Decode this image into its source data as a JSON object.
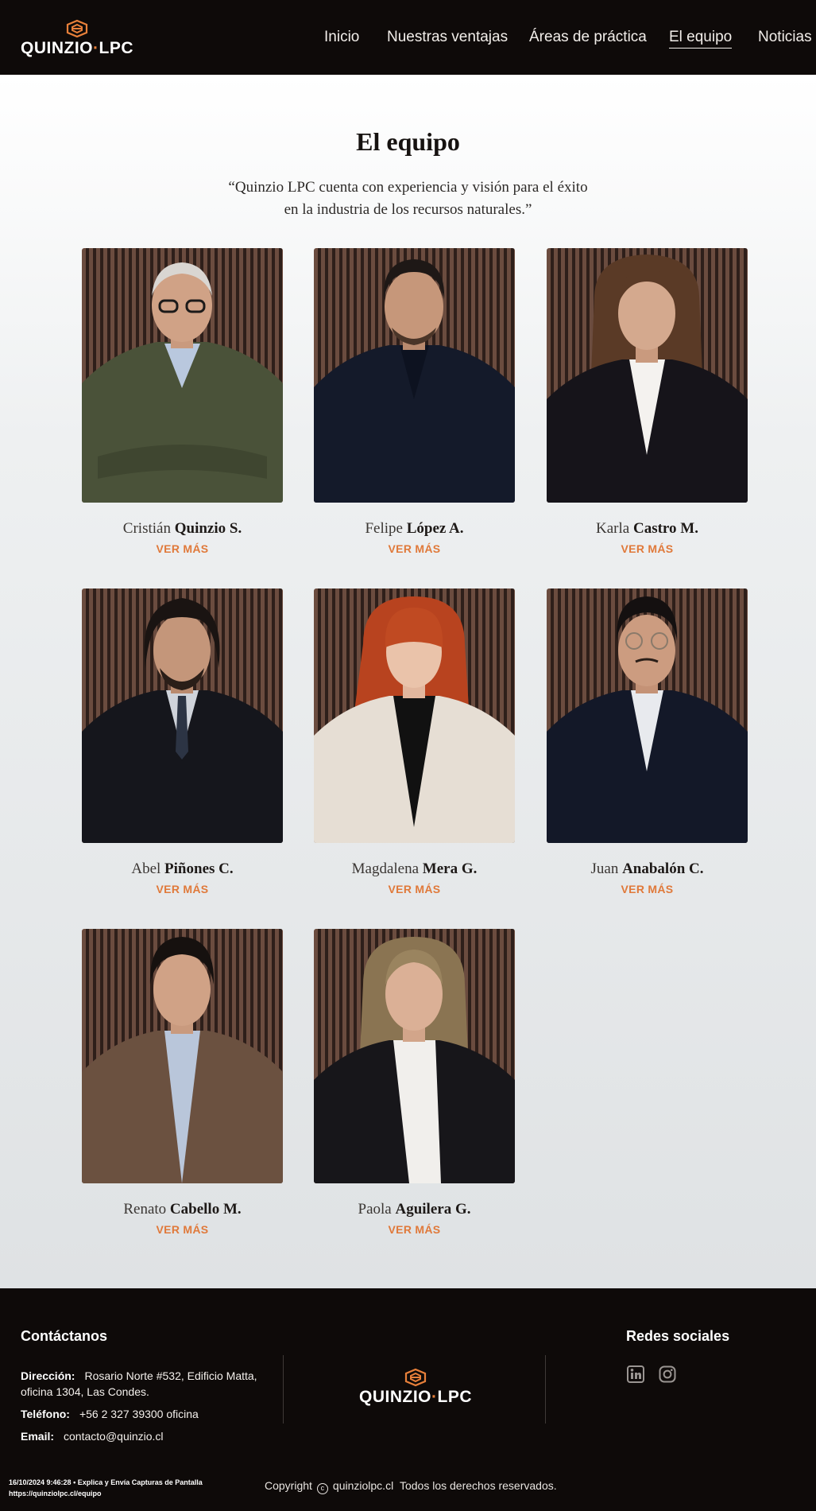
{
  "brand": {
    "name_left": "QUINZIO",
    "name_sep": "·",
    "name_right": "LPC"
  },
  "nav": [
    {
      "label": "Inicio",
      "active": false
    },
    {
      "label": "Nuestras ventajas",
      "active": false
    },
    {
      "label": "Áreas de práctica",
      "active": false
    },
    {
      "label": "El equipo",
      "active": true
    },
    {
      "label": "Noticias",
      "active": false
    }
  ],
  "page": {
    "title": "El equipo",
    "quote_line1": "“Quinzio LPC cuenta con experiencia y visión para el éxito",
    "quote_line2": "en la industria de los recursos naturales.”"
  },
  "team": [
    {
      "first": "Cristián",
      "last": "Quinzio S.",
      "link": "VER MÁS"
    },
    {
      "first": "Felipe",
      "last": "López A.",
      "link": "VER MÁS"
    },
    {
      "first": "Karla",
      "last": "Castro M.",
      "link": "VER MÁS"
    },
    {
      "first": "Abel",
      "last": "Piñones C.",
      "link": "VER MÁS"
    },
    {
      "first": "Magdalena",
      "last": "Mera G.",
      "link": "VER MÁS"
    },
    {
      "first": "Juan",
      "last": "Anabalón C.",
      "link": "VER MÁS"
    },
    {
      "first": "Renato",
      "last": "Cabello M.",
      "link": "VER MÁS"
    },
    {
      "first": "Paola",
      "last": "Aguilera G.",
      "link": "VER MÁS"
    }
  ],
  "footer": {
    "contact_heading": "Contáctanos",
    "address_label": "Dirección:",
    "address_line1": "Rosario Norte #532, Edificio Matta,",
    "address_line2": "oficina 1304, Las Condes.",
    "phone_label": "Teléfono:",
    "phone_value": "+56 2 327 39300 oficina",
    "email_label": "Email:",
    "email_value": "contacto@quinzio.cl",
    "social_heading": "Redes sociales",
    "social_icons": [
      "linkedin-icon",
      "instagram-icon"
    ],
    "copyright_label": "Copyright",
    "copyright_site": "quinziolpc.cl",
    "copyright_rights": "Todos los derechos reservados."
  },
  "capture_stamp": {
    "line1": "16/10/2024 9:46:28 • Explica y Envía Capturas de Pantalla",
    "line2": "https://quinziolpc.cl/equipo"
  },
  "colors": {
    "background_dark": "#0e0a09",
    "accent": "#e0793a"
  }
}
